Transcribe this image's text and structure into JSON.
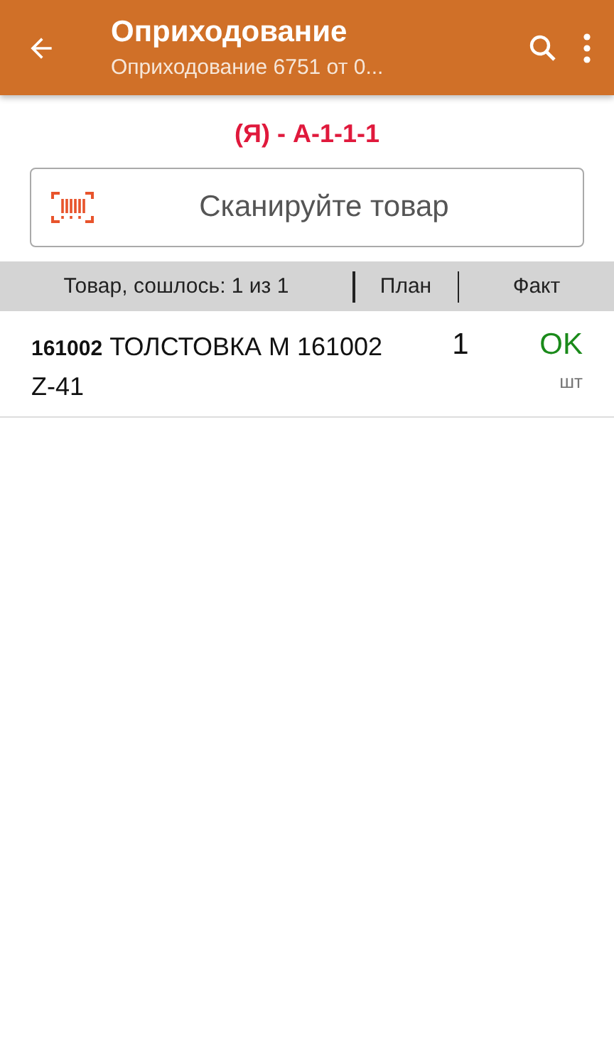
{
  "app_bar": {
    "title": "Оприходование",
    "subtitle": "Оприходование 6751 от 0..."
  },
  "location": "(Я) - А-1-1-1",
  "scan_field": {
    "placeholder": "Сканируйте товар"
  },
  "table": {
    "columns": [
      "Товар, сошлось: 1 из 1",
      "План",
      "Факт"
    ],
    "rows": [
      {
        "name": "**161002** ТОЛСТОВКА М 161002 Z-41",
        "plan": "1",
        "fact": "OK",
        "unit": "шт"
      }
    ]
  }
}
